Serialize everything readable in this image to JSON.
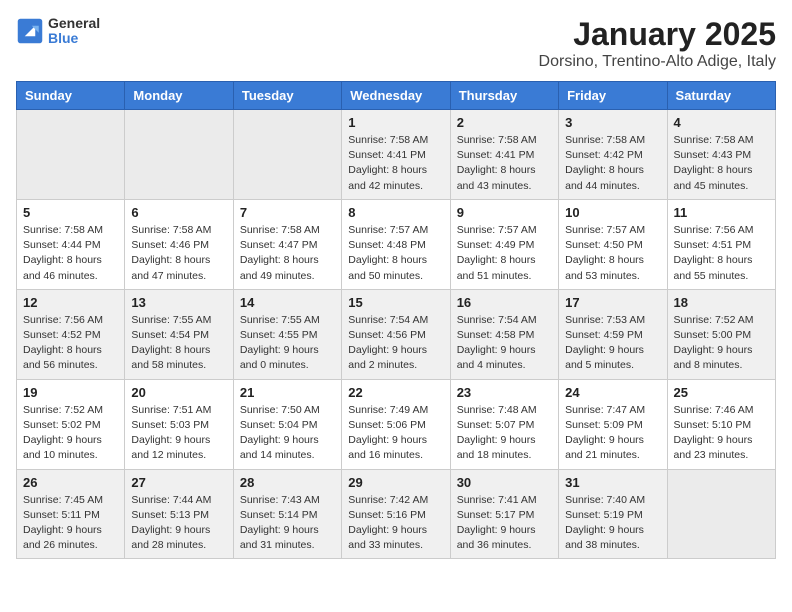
{
  "logo": {
    "general": "General",
    "blue": "Blue"
  },
  "title": "January 2025",
  "location": "Dorsino, Trentino-Alto Adige, Italy",
  "headers": [
    "Sunday",
    "Monday",
    "Tuesday",
    "Wednesday",
    "Thursday",
    "Friday",
    "Saturday"
  ],
  "weeks": [
    [
      {
        "day": "",
        "info": ""
      },
      {
        "day": "",
        "info": ""
      },
      {
        "day": "",
        "info": ""
      },
      {
        "day": "1",
        "info": "Sunrise: 7:58 AM\nSunset: 4:41 PM\nDaylight: 8 hours and 42 minutes."
      },
      {
        "day": "2",
        "info": "Sunrise: 7:58 AM\nSunset: 4:41 PM\nDaylight: 8 hours and 43 minutes."
      },
      {
        "day": "3",
        "info": "Sunrise: 7:58 AM\nSunset: 4:42 PM\nDaylight: 8 hours and 44 minutes."
      },
      {
        "day": "4",
        "info": "Sunrise: 7:58 AM\nSunset: 4:43 PM\nDaylight: 8 hours and 45 minutes."
      }
    ],
    [
      {
        "day": "5",
        "info": "Sunrise: 7:58 AM\nSunset: 4:44 PM\nDaylight: 8 hours and 46 minutes."
      },
      {
        "day": "6",
        "info": "Sunrise: 7:58 AM\nSunset: 4:46 PM\nDaylight: 8 hours and 47 minutes."
      },
      {
        "day": "7",
        "info": "Sunrise: 7:58 AM\nSunset: 4:47 PM\nDaylight: 8 hours and 49 minutes."
      },
      {
        "day": "8",
        "info": "Sunrise: 7:57 AM\nSunset: 4:48 PM\nDaylight: 8 hours and 50 minutes."
      },
      {
        "day": "9",
        "info": "Sunrise: 7:57 AM\nSunset: 4:49 PM\nDaylight: 8 hours and 51 minutes."
      },
      {
        "day": "10",
        "info": "Sunrise: 7:57 AM\nSunset: 4:50 PM\nDaylight: 8 hours and 53 minutes."
      },
      {
        "day": "11",
        "info": "Sunrise: 7:56 AM\nSunset: 4:51 PM\nDaylight: 8 hours and 55 minutes."
      }
    ],
    [
      {
        "day": "12",
        "info": "Sunrise: 7:56 AM\nSunset: 4:52 PM\nDaylight: 8 hours and 56 minutes."
      },
      {
        "day": "13",
        "info": "Sunrise: 7:55 AM\nSunset: 4:54 PM\nDaylight: 8 hours and 58 minutes."
      },
      {
        "day": "14",
        "info": "Sunrise: 7:55 AM\nSunset: 4:55 PM\nDaylight: 9 hours and 0 minutes."
      },
      {
        "day": "15",
        "info": "Sunrise: 7:54 AM\nSunset: 4:56 PM\nDaylight: 9 hours and 2 minutes."
      },
      {
        "day": "16",
        "info": "Sunrise: 7:54 AM\nSunset: 4:58 PM\nDaylight: 9 hours and 4 minutes."
      },
      {
        "day": "17",
        "info": "Sunrise: 7:53 AM\nSunset: 4:59 PM\nDaylight: 9 hours and 5 minutes."
      },
      {
        "day": "18",
        "info": "Sunrise: 7:52 AM\nSunset: 5:00 PM\nDaylight: 9 hours and 8 minutes."
      }
    ],
    [
      {
        "day": "19",
        "info": "Sunrise: 7:52 AM\nSunset: 5:02 PM\nDaylight: 9 hours and 10 minutes."
      },
      {
        "day": "20",
        "info": "Sunrise: 7:51 AM\nSunset: 5:03 PM\nDaylight: 9 hours and 12 minutes."
      },
      {
        "day": "21",
        "info": "Sunrise: 7:50 AM\nSunset: 5:04 PM\nDaylight: 9 hours and 14 minutes."
      },
      {
        "day": "22",
        "info": "Sunrise: 7:49 AM\nSunset: 5:06 PM\nDaylight: 9 hours and 16 minutes."
      },
      {
        "day": "23",
        "info": "Sunrise: 7:48 AM\nSunset: 5:07 PM\nDaylight: 9 hours and 18 minutes."
      },
      {
        "day": "24",
        "info": "Sunrise: 7:47 AM\nSunset: 5:09 PM\nDaylight: 9 hours and 21 minutes."
      },
      {
        "day": "25",
        "info": "Sunrise: 7:46 AM\nSunset: 5:10 PM\nDaylight: 9 hours and 23 minutes."
      }
    ],
    [
      {
        "day": "26",
        "info": "Sunrise: 7:45 AM\nSunset: 5:11 PM\nDaylight: 9 hours and 26 minutes."
      },
      {
        "day": "27",
        "info": "Sunrise: 7:44 AM\nSunset: 5:13 PM\nDaylight: 9 hours and 28 minutes."
      },
      {
        "day": "28",
        "info": "Sunrise: 7:43 AM\nSunset: 5:14 PM\nDaylight: 9 hours and 31 minutes."
      },
      {
        "day": "29",
        "info": "Sunrise: 7:42 AM\nSunset: 5:16 PM\nDaylight: 9 hours and 33 minutes."
      },
      {
        "day": "30",
        "info": "Sunrise: 7:41 AM\nSunset: 5:17 PM\nDaylight: 9 hours and 36 minutes."
      },
      {
        "day": "31",
        "info": "Sunrise: 7:40 AM\nSunset: 5:19 PM\nDaylight: 9 hours and 38 minutes."
      },
      {
        "day": "",
        "info": ""
      }
    ]
  ]
}
